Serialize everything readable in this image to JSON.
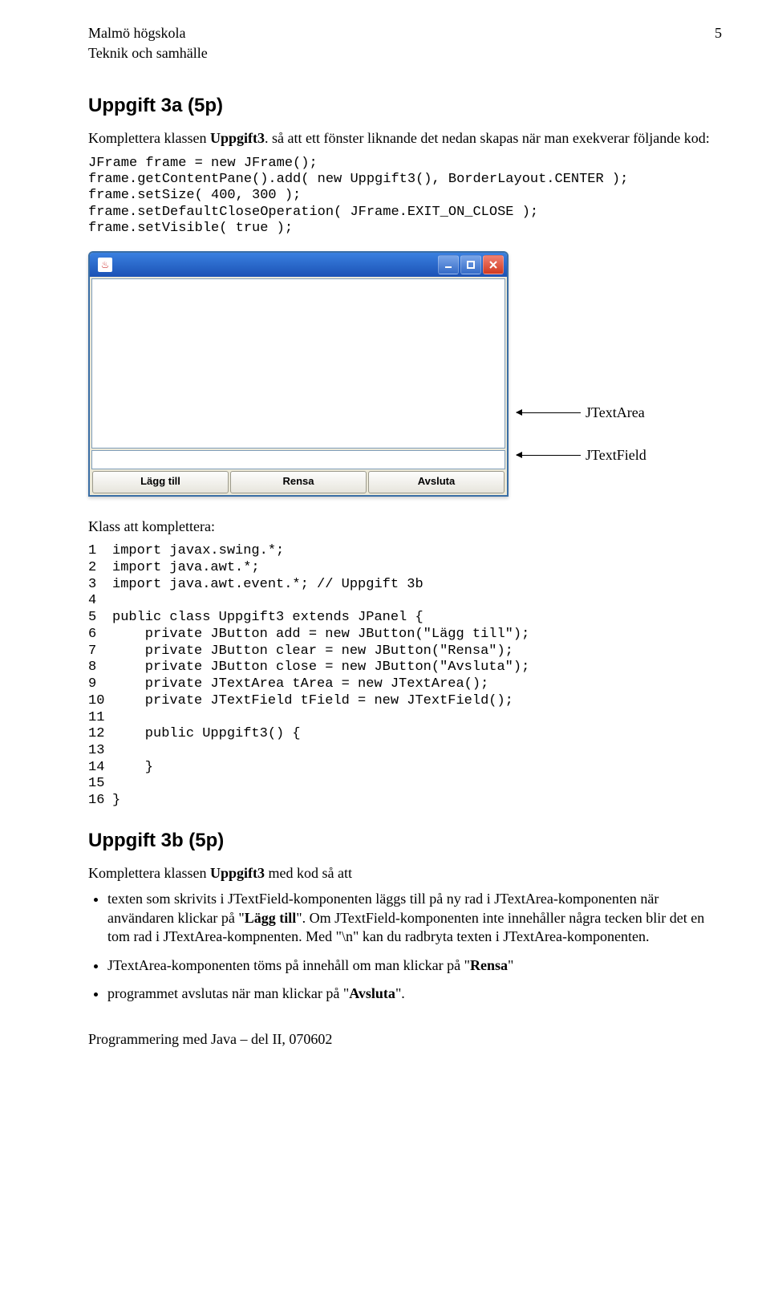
{
  "header": {
    "inst_line1": "Malmö högskola",
    "inst_line2": "Teknik och samhälle",
    "page_num": "5"
  },
  "section_a": {
    "heading": "Uppgift 3a (5p)",
    "intro_prefix": "Komplettera klassen ",
    "intro_bold": "Uppgift3",
    "intro_suffix": ". så att ett fönster liknande det nedan skapas när man exekverar följande kod:",
    "code": "JFrame frame = new JFrame();\nframe.getContentPane().add( new Uppgift3(), BorderLayout.CENTER );\nframe.setSize( 400, 300 );\nframe.setDefaultCloseOperation( JFrame.EXIT_ON_CLOSE );\nframe.setVisible( true );"
  },
  "window": {
    "buttons": {
      "add": "Lägg till",
      "clear": "Rensa",
      "close": "Avsluta"
    },
    "annot_textarea": "JTextArea",
    "annot_textfield": "JTextField"
  },
  "listing": {
    "caption": "Klass att komplettera:",
    "lines": [
      "import javax.swing.*;",
      "import java.awt.*;",
      "import java.awt.event.*; // Uppgift 3b",
      "",
      "public class Uppgift3 extends JPanel {",
      "    private JButton add = new JButton(\"Lägg till\");",
      "    private JButton clear = new JButton(\"Rensa\");",
      "    private JButton close = new JButton(\"Avsluta\");",
      "    private JTextArea tArea = new JTextArea();",
      "    private JTextField tField = new JTextField();",
      "",
      "    public Uppgift3() {",
      "",
      "    }",
      "",
      "}"
    ]
  },
  "section_b": {
    "heading": "Uppgift 3b (5p)",
    "intro_prefix": "Komplettera klassen ",
    "intro_bold": "Uppgift3",
    "intro_suffix": " med kod så att",
    "bullets": [
      {
        "pre": "texten som skrivits i JTextField-komponenten läggs till på ny rad i JTextArea-komponenten när användaren klickar på \"",
        "bold": "Lägg till",
        "post": "\". Om JTextField-komponenten inte innehåller några tecken blir det en tom rad i JTextArea-kompnenten. Med \"\\n\" kan du radbryta texten i JTextArea-komponenten."
      },
      {
        "pre": "JTextArea-komponenten töms på innehåll om man klickar på \"",
        "bold": "Rensa",
        "post": "\""
      },
      {
        "pre": "programmet avslutas när man klickar på \"",
        "bold": "Avsluta",
        "post": "\"."
      }
    ]
  },
  "footer": "Programmering med Java – del II, 070602"
}
